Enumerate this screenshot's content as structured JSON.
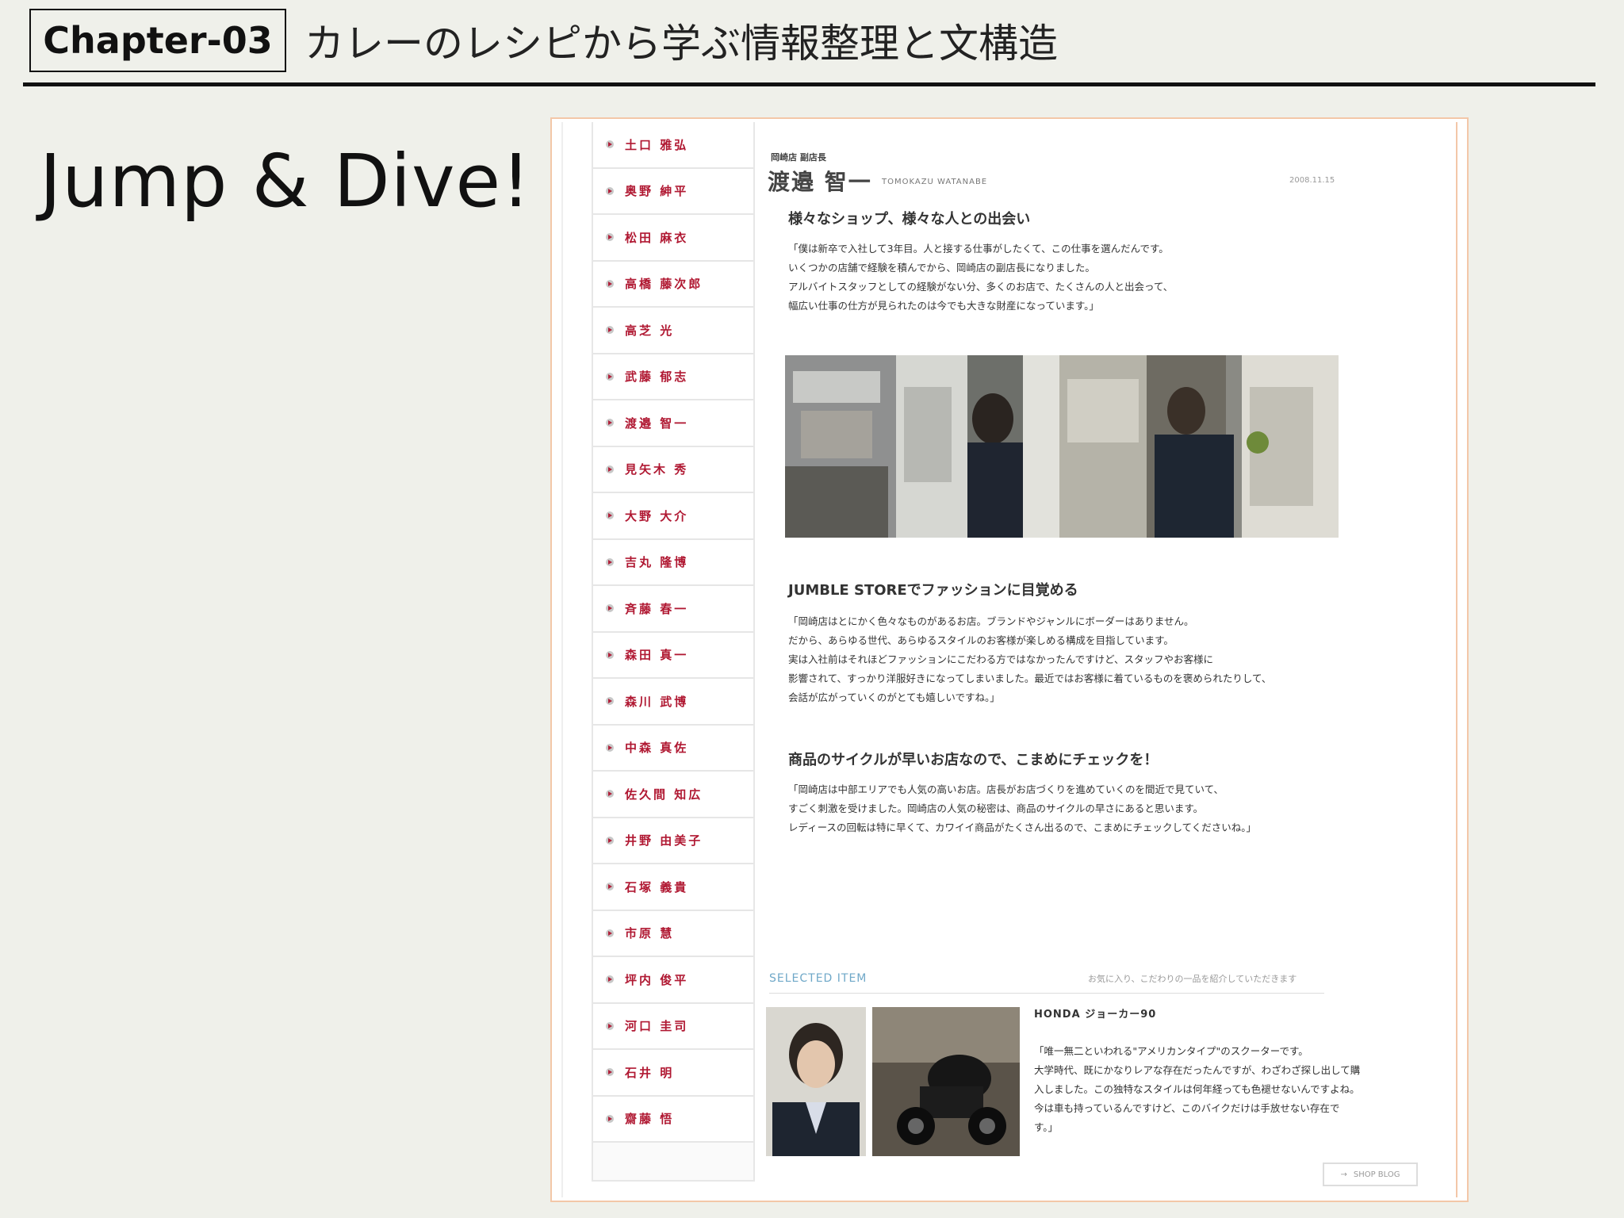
{
  "header": {
    "chapter_label": "Chapter-03",
    "title": "カレーのレシピから学ぶ情報整理と文構造"
  },
  "slide_heading": "Jump & Dive!",
  "page": {
    "staff_nav": [
      "土口 雅弘",
      "奥野 紳平",
      "松田 麻衣",
      "高橋 藤次郎",
      "高芝 光",
      "武藤 郁志",
      "渡邉 智一",
      "見矢木 秀",
      "大野 大介",
      "吉丸 隆博",
      "斉藤 春一",
      "森田 真一",
      "森川 武博",
      "中森 真佐",
      "佐久間 知広",
      "井野 由美子",
      "石塚 義貴",
      "市原 慧",
      "坪内 俊平",
      "河口 圭司",
      "石井 明",
      "齋藤 悟"
    ],
    "role": "岡崎店 副店長",
    "name": "渡邉 智一",
    "romaji": "TOMOKAZU WATANABE",
    "date": "2008.11.15",
    "sections": [
      {
        "title": "様々なショップ、様々な人との出会い",
        "lines": [
          "「僕は新卒で入社して3年目。人と接する仕事がしたくて、この仕事を選んだんです。",
          "いくつかの店舗で経験を積んでから、岡崎店の副店長になりました。",
          "アルバイトスタッフとしての経験がない分、多くのお店で、たくさんの人と出会って、",
          "幅広い仕事の仕方が見られたのは今でも大きな財産になっています。」"
        ]
      },
      {
        "title": "JUMBLE STOREでファッションに目覚める",
        "lines": [
          "「岡崎店はとにかく色々なものがあるお店。ブランドやジャンルにボーダーはありません。",
          "だから、あらゆる世代、あらゆるスタイルのお客様が楽しめる構成を目指しています。",
          "実は入社前はそれほどファッションにこだわる方ではなかったんですけど、スタッフやお客様に",
          "影響されて、すっかり洋服好きになってしまいました。最近ではお客様に着ているものを褒められたりして、",
          "会話が広がっていくのがとても嬉しいですね。」"
        ]
      },
      {
        "title": "商品のサイクルが早いお店なので、こまめにチェックを！",
        "lines": [
          "「岡崎店は中部エリアでも人気の高いお店。店長がお店づくりを進めていくのを間近で見ていて、",
          "すごく刺激を受けました。岡崎店の人気の秘密は、商品のサイクルの早さにあると思います。",
          "レディースの回転は特に早くて、カワイイ商品がたくさん出るので、こまめにチェックしてくださいね。」"
        ]
      }
    ],
    "selected": {
      "label": "SELECTED ITEM",
      "note": "お気に入り、こだわりの一品を紹介していただきます",
      "item_name": "HONDA ジョーカー90",
      "desc_lines": [
        "「唯一無二といわれる\"アメリカンタイプ\"のスクーターです。",
        "大学時代、既にかなりレアな存在だったんですが、わざわざ探し出して購",
        "入しました。この独特なスタイルは何年経っても色褪せないんですよね。",
        "今は車も持っているんですけど、このバイクだけは手放せない存在で",
        "す。」"
      ]
    },
    "shop_blog": "SHOP BLOG"
  }
}
